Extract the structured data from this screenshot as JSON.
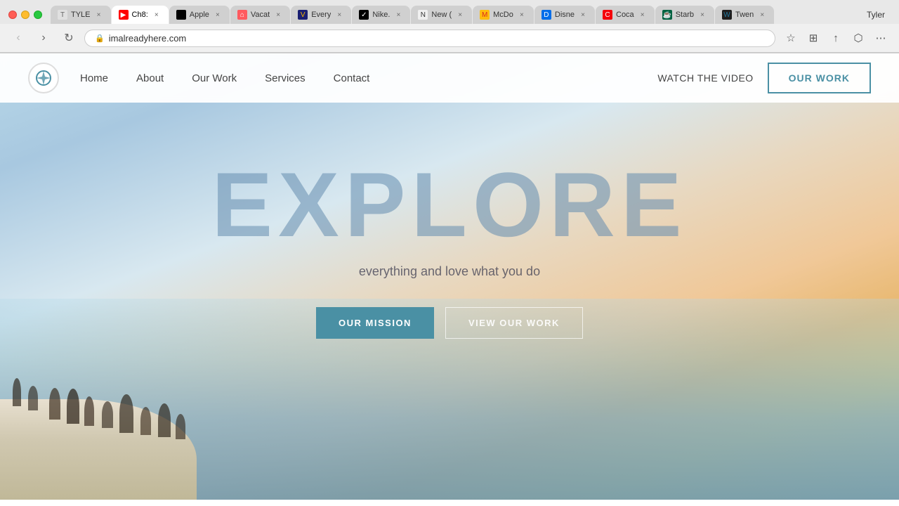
{
  "browser": {
    "url": "imalreadyhere.com",
    "user": "Tyler",
    "tabs": [
      {
        "id": "tyler",
        "label": "TYLE",
        "favicon": "T",
        "faviconClass": "fav-tyler",
        "active": false
      },
      {
        "id": "youtube",
        "label": "Ch8:",
        "favicon": "▶",
        "faviconClass": "fav-youtube",
        "active": true
      },
      {
        "id": "apple",
        "label": "Apple",
        "favicon": "",
        "faviconClass": "fav-apple",
        "active": false
      },
      {
        "id": "airbnb",
        "label": "Vacat",
        "favicon": "⌂",
        "faviconClass": "fav-airbnb",
        "active": false
      },
      {
        "id": "visa",
        "label": "Every",
        "favicon": "V",
        "faviconClass": "fav-visa",
        "active": false
      },
      {
        "id": "nike",
        "label": "Nike.",
        "favicon": "✓",
        "faviconClass": "fav-nike",
        "active": false
      },
      {
        "id": "newt",
        "label": "New (",
        "favicon": "N",
        "faviconClass": "fav-newt",
        "active": false
      },
      {
        "id": "mcd",
        "label": "McDo",
        "favicon": "M",
        "faviconClass": "fav-mcd",
        "active": false
      },
      {
        "id": "disney",
        "label": "Disne",
        "favicon": "D",
        "faviconClass": "fav-disney",
        "active": false
      },
      {
        "id": "coca",
        "label": "Coca",
        "favicon": "C",
        "faviconClass": "fav-coca",
        "active": false
      },
      {
        "id": "starbucks",
        "label": "Starb",
        "favicon": "☕",
        "faviconClass": "fav-starbucks",
        "active": false
      },
      {
        "id": "twenty",
        "label": "Twen",
        "favicon": "W",
        "faviconClass": "fav-twenty",
        "active": false
      }
    ]
  },
  "nav": {
    "logo_icon": "◎",
    "links": [
      "Home",
      "About",
      "Our Work",
      "Services",
      "Contact"
    ],
    "watch_video": "WATCH THE VIDEO",
    "our_work_btn": "OUR WORK"
  },
  "hero": {
    "title": "EXPLORE",
    "tagline": "everything and love what you do",
    "mission_btn": "OUR MISSION",
    "view_work_btn": "VIEW OUR WORK"
  }
}
